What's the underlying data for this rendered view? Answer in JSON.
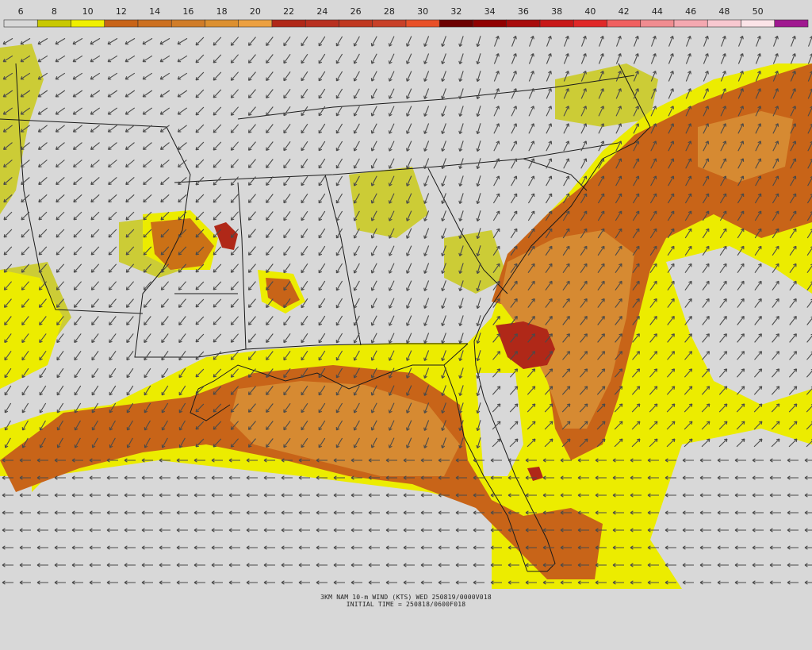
{
  "colorbar": {
    "labels": [
      "6",
      "8",
      "10",
      "12",
      "14",
      "16",
      "18",
      "20",
      "22",
      "24",
      "26",
      "28",
      "30",
      "32",
      "34",
      "36",
      "38",
      "40",
      "42",
      "44",
      "46",
      "48",
      "50"
    ],
    "colors": [
      "#d8d8d8",
      "#c8c800",
      "#f0f000",
      "#c86418",
      "#cc7020",
      "#d07c28",
      "#dc9030",
      "#eca040",
      "#b02818",
      "#b83020",
      "#c03820",
      "#c84028",
      "#e85028",
      "#6c0000",
      "#900000",
      "#a80c0c",
      "#c81818",
      "#e02828",
      "#f06060",
      "#f08c90",
      "#f4a8b0",
      "#f8c8d0",
      "#fce4e8",
      "#a01890"
    ]
  },
  "map": {
    "colors": {
      "background": "#d8d8d8",
      "borders": "#1a1a1a",
      "arrows": "#4a4a4a",
      "level_8": "#c8c800",
      "level_10": "#ecec00",
      "level_12": "#c86418",
      "level_16": "#d68a32",
      "level_22": "#b02818"
    }
  },
  "caption": {
    "line1": "3KM NAM 10-m WIND (KTS) WED 250819/0000V018",
    "line2": "INITIAL TIME = 250818/0600F018"
  }
}
